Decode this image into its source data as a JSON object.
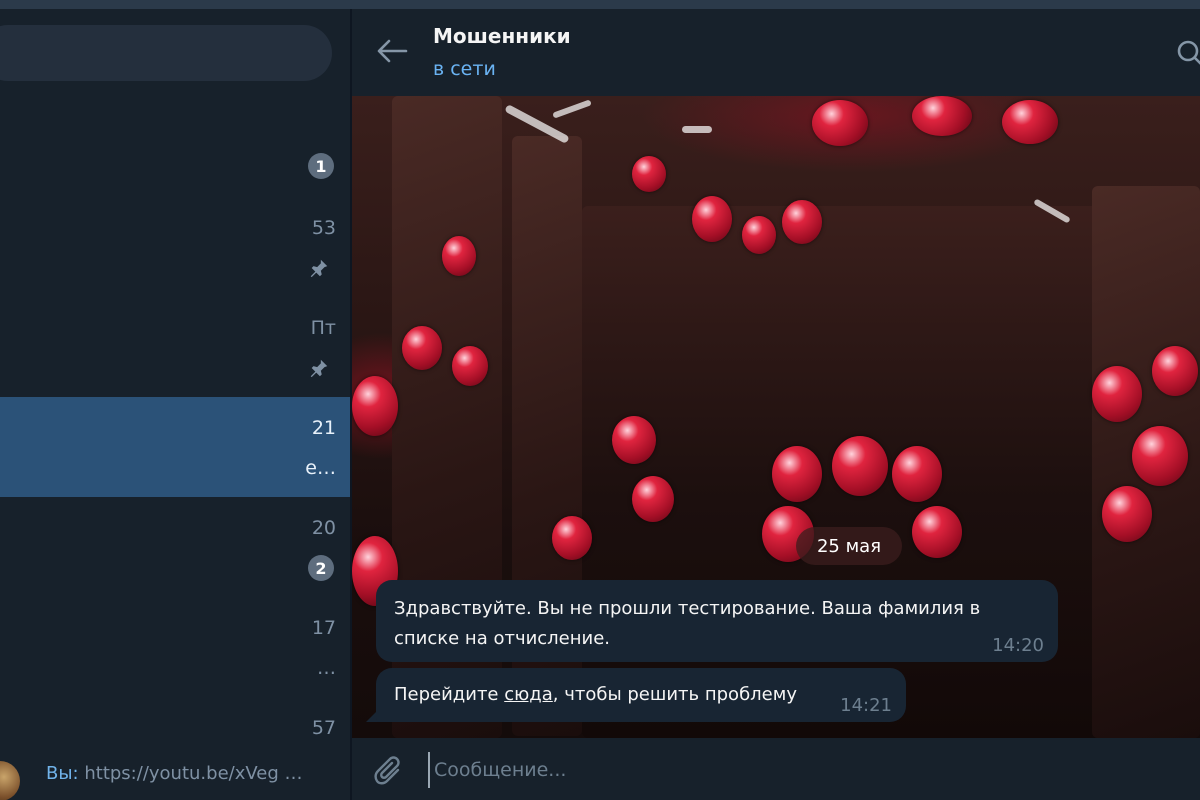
{
  "chat_list": {
    "times": [
      "53",
      "Пт",
      "21",
      "20",
      "17",
      "57"
    ],
    "unread_badges": [
      "1",
      "2"
    ],
    "active_row_snippet": "е…",
    "row_snippet_17": "…",
    "bottom_preview": {
      "sender": "Вы:",
      "text": "https://youtu.be/xVeg …"
    }
  },
  "header": {
    "title": "Мошенники",
    "status": "в сети"
  },
  "conversation": {
    "date_separator": "25 мая",
    "messages": [
      {
        "text": "Здравствуйте. Вы не прошли тестирование. Ваша фамилия в списке на отчисление.",
        "time": "14:20"
      },
      {
        "text_before": "Перейдите ",
        "link_text": "сюда",
        "text_after": ", чтобы решить проблему",
        "time": "14:21"
      }
    ]
  },
  "composer": {
    "placeholder": "Сообщение..."
  },
  "colors": {
    "background": "#17212b",
    "bubble": "#182533",
    "accent": "#6ab3f3",
    "active_chat": "#2b5278",
    "badge": "#5e6d7e"
  },
  "icons": [
    "back-arrow-icon",
    "search-icon",
    "pin-icon",
    "paperclip-icon"
  ]
}
